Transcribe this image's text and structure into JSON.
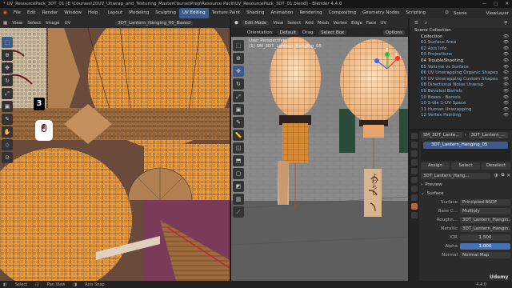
{
  "window": {
    "title": "* UV_ResourcePack_3DT_01 [E:\\Courses\\20UV_Unwrap_and_Texturing_MasterCourse\\Prep\\Resource Pack\\UV_ResourcePack_3DT_01.blend] - Blender 4.4.0",
    "controls": [
      "—",
      "□",
      "✕"
    ]
  },
  "menu": [
    "File",
    "Edit",
    "Render",
    "Window",
    "Help"
  ],
  "workspaces": [
    "Layout",
    "Modeling",
    "Sculpting",
    "UV Editing",
    "Texture Paint",
    "Shading",
    "Animation",
    "Rendering",
    "Compositing",
    "Geometry Nodes",
    "Scripting"
  ],
  "active_workspace": "UV Editing",
  "scene": {
    "label": "Scene",
    "view_layer": "ViewLayer"
  },
  "uv_editor": {
    "header_items": [
      "View",
      "Select",
      "Image",
      "UV"
    ],
    "image_name": "3DT_Lantern_Hanging_05_Basecl",
    "badge_number": "3"
  },
  "viewport": {
    "mode": "Edit Mode",
    "header_items": [
      "View",
      "Select",
      "Add",
      "Mesh",
      "Vertex",
      "Edge",
      "Face",
      "UV"
    ],
    "orientation_label": "Orientation:",
    "orientation": "Default",
    "drag_label": "Drag:",
    "drag": "Select Box",
    "options": "Options",
    "perspective": "User Perspective",
    "object_info": "(1) SM_3DT_Lantern_Hanging_05",
    "axes": {
      "x": "X",
      "y": "Y",
      "z": "Z"
    },
    "sign_text": "よわらし"
  },
  "outliner": {
    "root": "Scene Collection",
    "items": [
      "Collection",
      "01 Surface Area",
      "02 Axis Info",
      "03 Projections",
      "04 TroubleShooting",
      "05 Volume vs Surface",
      "06 UV Unwrapping Organic Shapes",
      "07 UV Unwrapping Custom Shapes",
      "08 Directional Noise Unwrap",
      "09 Beveled Barrels",
      "10 Boxes - Barrels",
      "10 S-tile 1-UV Space",
      "11 Human Unwrapping",
      "12 Vertex Painting"
    ]
  },
  "properties": {
    "breadcrumb_object": "SM_3DT_Lante...",
    "breadcrumb_material": "3DT_Lantern_...",
    "material_slot": "3DT_Lantern_Hanging_05",
    "buttons": [
      "Assign",
      "Select",
      "Deselect"
    ],
    "material_name": "3DT_Lantern_Hang...",
    "preview_label": "Preview",
    "surface_label": "Surface",
    "fields": [
      {
        "label": "Surface",
        "value": "Principled BSDF"
      },
      {
        "label": "Base C...",
        "value": "Multiply"
      },
      {
        "label": "Roughn...",
        "value": "3DT_Lantern_Hangin..."
      },
      {
        "label": "Metallic",
        "value": "3DT_Lantern_Hangin..."
      },
      {
        "label": "IOR",
        "value": "1.500"
      },
      {
        "label": "Alpha",
        "value": "1.000"
      },
      {
        "label": "Normal",
        "value": "Normal Map"
      }
    ]
  },
  "status": {
    "items": [
      "Select",
      "Pan View",
      "Axis Snap"
    ],
    "version": "4.4.0"
  },
  "watermark": "Udemy",
  "colors": {
    "accent": "#3d5a8a",
    "uv_orange": "#e89a3a",
    "background": "#1d1d1d"
  }
}
